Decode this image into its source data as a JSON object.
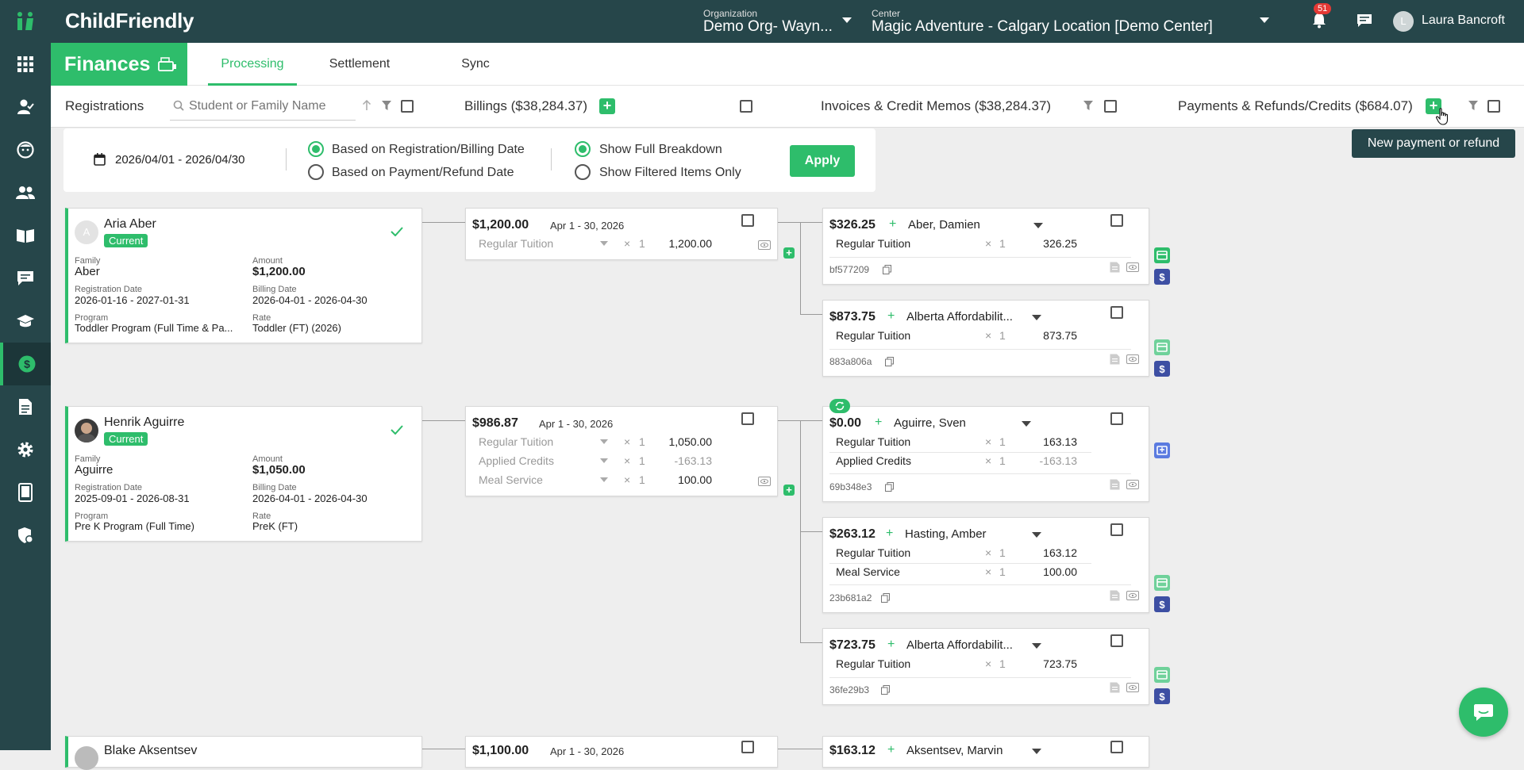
{
  "app": {
    "logo": "ChildFriendly"
  },
  "header": {
    "org_label": "Organization",
    "org_value": "Demo Org- Wayn...",
    "center_label": "Center",
    "center_value": "Magic Adventure - Calgary Location [Demo Center]",
    "notification_count": "51",
    "user_initial": "L",
    "user_name": "Laura Bancroft"
  },
  "nav": {
    "section": "Finances",
    "tabs": [
      "Processing",
      "Settlement",
      "Sync"
    ]
  },
  "columns": {
    "registrations": "Registrations",
    "search_placeholder": "Student or Family Name",
    "billings": "Billings ($38,284.37)",
    "invoices": "Invoices & Credit Memos ($38,284.37)",
    "payments": "Payments & Refunds/Credits ($684.07)"
  },
  "tooltip": "New payment or refund",
  "filters": {
    "date_range": "2026/04/01 - 2026/04/30",
    "opt1": "Based on Registration/Billing Date",
    "opt2": "Based on Payment/Refund Date",
    "opt3": "Show Full Breakdown",
    "opt4": "Show Filtered Items Only",
    "apply": "Apply"
  },
  "labels": {
    "family": "Family",
    "amount": "Amount",
    "reg_date": "Registration Date",
    "billing_date": "Billing Date",
    "program": "Program",
    "rate": "Rate"
  },
  "registrations": [
    {
      "initial": "A",
      "name": "Aria Aber",
      "status": "Current",
      "family": "Aber",
      "amount": "$1,200.00",
      "reg_date": "2026-01-16 - 2027-01-31",
      "billing_date": "2026-04-01 - 2026-04-30",
      "program": "Toddler Program (Full Time & Pa...",
      "rate": "Toddler (FT) (2026)"
    },
    {
      "name": "Henrik Aguirre",
      "status": "Current",
      "family": "Aguirre",
      "amount": "$1,050.00",
      "reg_date": "2025-09-01 - 2026-08-31",
      "billing_date": "2026-04-01 - 2026-04-30",
      "program": "Pre K Program (Full Time)",
      "rate": "PreK (FT)"
    },
    {
      "name": "Blake Aksentsev"
    }
  ],
  "billings": [
    {
      "total": "$1,200.00",
      "period": "Apr 1 - 30, 2026",
      "rows": [
        {
          "label": "Regular Tuition",
          "qty": "1",
          "value": "1,200.00"
        }
      ]
    },
    {
      "total": "$986.87",
      "period": "Apr 1 - 30, 2026",
      "rows": [
        {
          "label": "Regular Tuition",
          "qty": "1",
          "value": "1,050.00"
        },
        {
          "label": "Applied Credits",
          "qty": "1",
          "value": "-163.13"
        },
        {
          "label": "Meal Service",
          "qty": "1",
          "value": "100.00"
        }
      ]
    },
    {
      "total": "$1,100.00",
      "period": "Apr 1 - 30, 2026"
    }
  ],
  "invoices": [
    {
      "total": "$326.25",
      "payer": "Aber, Damien",
      "rows": [
        {
          "label": "Regular Tuition",
          "qty": "1",
          "value": "326.25"
        }
      ],
      "id": "bf577209"
    },
    {
      "total": "$873.75",
      "payer": "Alberta Affordabilit...",
      "rows": [
        {
          "label": "Regular Tuition",
          "qty": "1",
          "value": "873.75"
        }
      ],
      "id": "883a806a"
    },
    {
      "total": "$0.00",
      "payer": "Aguirre, Sven",
      "rows": [
        {
          "label": "Regular Tuition",
          "qty": "1",
          "value": "163.13"
        },
        {
          "label": "Applied Credits",
          "qty": "1",
          "value": "-163.13"
        }
      ],
      "id": "69b348e3"
    },
    {
      "total": "$263.12",
      "payer": "Hasting, Amber",
      "rows": [
        {
          "label": "Regular Tuition",
          "qty": "1",
          "value": "163.12"
        },
        {
          "label": "Meal Service",
          "qty": "1",
          "value": "100.00"
        }
      ],
      "id": "23b681a2"
    },
    {
      "total": "$723.75",
      "payer": "Alberta Affordabilit...",
      "rows": [
        {
          "label": "Regular Tuition",
          "qty": "1",
          "value": "723.75"
        }
      ],
      "id": "36fe29b3"
    },
    {
      "total": "$163.12",
      "payer": "Aksentsev, Marvin"
    }
  ],
  "colors": {
    "sidebar": "#26464a",
    "accent": "#2ebd6b",
    "tooltip": "#26464a",
    "pay_icon": "#3d4fa3"
  }
}
